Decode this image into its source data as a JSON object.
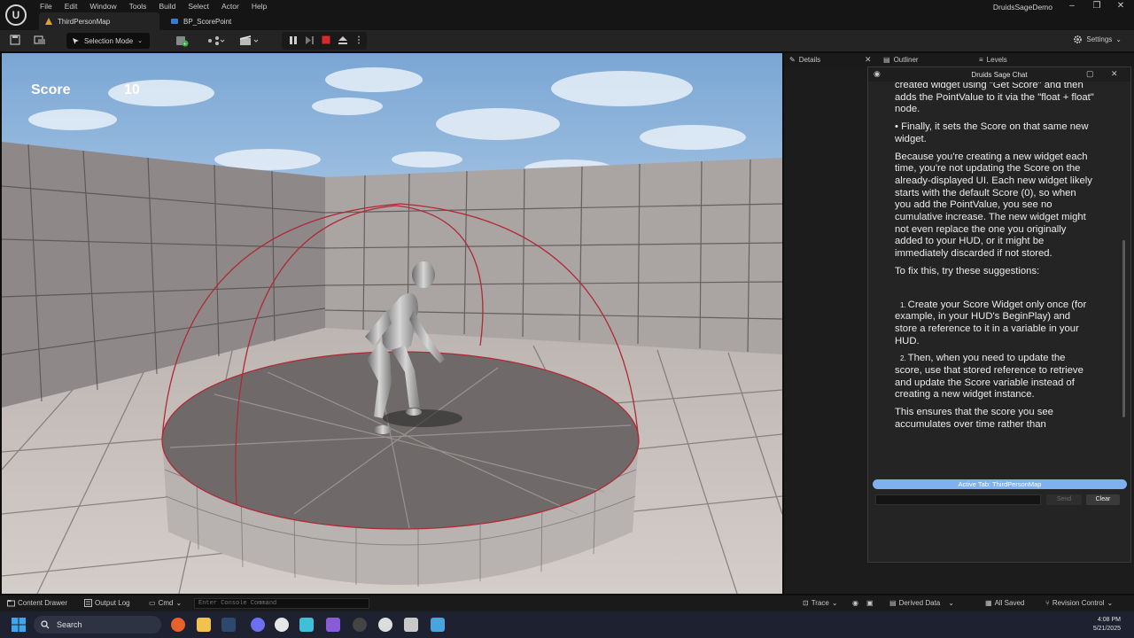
{
  "menu": [
    "File",
    "Edit",
    "Window",
    "Tools",
    "Build",
    "Select",
    "Actor",
    "Help"
  ],
  "tabs": [
    {
      "label": "ThirdPersonMap",
      "icon": "level-icon"
    },
    {
      "label": "BP_ScorePoint",
      "icon": "blueprint-icon"
    }
  ],
  "project_name": "DruidsSageDemo",
  "toolbar": {
    "mode_label": "Selection Mode",
    "settings_label": "Settings"
  },
  "viewport": {
    "score_label": "Score",
    "score_value": "10"
  },
  "panels": {
    "details_tab": "Details",
    "outliner_tab": "Outliner",
    "levels_tab": "Levels"
  },
  "chat": {
    "title": "Druids Sage Chat",
    "paragraphs": [
      "created widget using \"Get Score\" and then adds the PointValue to it via the \"float + float\" node.",
      "• Finally, it sets the Score on that same new widget.",
      "Because you're creating a new widget each time, you're not updating the Score on the already-displayed UI. Each new widget likely starts with the default Score (0), so when you add the PointValue, you see no cumulative increase. The new widget might not even replace the one you originally added to your HUD, or it might be immediately discarded if not stored.",
      "To fix this, try these suggestions:"
    ],
    "list": [
      {
        "num": "1.",
        "text": "Create your Score Widget only once (for example, in your HUD's BeginPlay) and store a reference to it in a variable in your HUD."
      },
      {
        "num": "2.",
        "text": "Then, when you need to update the score, use that stored reference to retrieve and update the Score variable instead of creating a new widget instance."
      }
    ],
    "closing": "This ensures that the score you see accumulates over time rather than",
    "active_tab": "Active Tab: ThirdPersonMap",
    "input_value": "",
    "send_label": "Send",
    "clear_label": "Clear"
  },
  "statusbar": {
    "content_drawer": "Content Drawer",
    "output_log": "Output Log",
    "cmd": "Cmd",
    "console_placeholder": "Enter Console Command",
    "trace": "Trace",
    "derived_data": "Derived Data",
    "all_saved": "All Saved",
    "revision_control": "Revision Control"
  },
  "taskbar": {
    "search_label": "Search",
    "time": "4:08 PM",
    "date": "5/21/2025"
  },
  "colors": {
    "accent_blue": "#7fb1f0",
    "stop_red": "#d42a2a",
    "sphere_outline": "#b02a35"
  }
}
